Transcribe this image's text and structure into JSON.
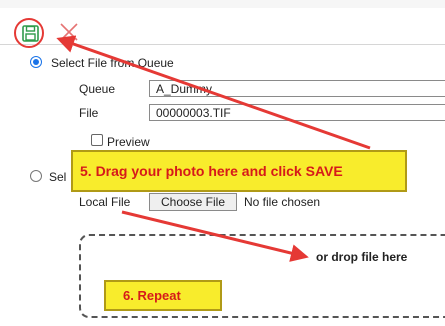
{
  "toolbar": {
    "save_icon": "floppy-disk-icon",
    "close_icon": "x-close-icon"
  },
  "option_queue": {
    "label": "Select File from Queue",
    "selected": true,
    "queue_label": "Queue",
    "queue_value": "A_Dummy",
    "file_label": "File",
    "file_value": "00000003.TIF",
    "preview_label": "Preview",
    "preview_checked": false
  },
  "option_local": {
    "label_partial": "Sel",
    "selected": false,
    "local_file_label": "Local File",
    "choose_file_label": "Choose File",
    "no_file_text": "No file chosen",
    "drop_text": "or drop file here"
  },
  "callouts": {
    "step5": "5. Drag your photo here and click SAVE",
    "step6": "6. Repeat"
  },
  "colors": {
    "callout_bg": "#f8ec2c",
    "callout_text": "#d61a1a",
    "arrow": "#e53935",
    "radio_accent": "#1a73e8",
    "save_icon": "#2e9b4a"
  }
}
